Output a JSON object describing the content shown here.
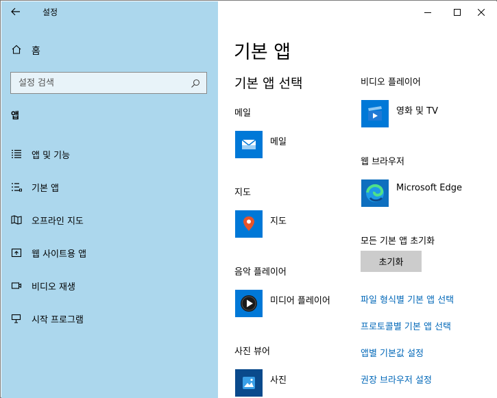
{
  "colors": {
    "sidebar_bg": "#acd7ed",
    "accent_tile": "#0078d7",
    "link": "#0067b8",
    "button_bg": "#cccccc"
  },
  "titlebar": {
    "app_title": "설정",
    "back_icon": "arrow-left-icon",
    "buttons": [
      "minimize-icon",
      "maximize-icon",
      "close-icon"
    ]
  },
  "sidebar": {
    "home_label": "홈",
    "search_placeholder": "설정 검색",
    "section_heading": "앱",
    "items": [
      {
        "label": "앱 및 기능",
        "icon": "apps-features-icon"
      },
      {
        "label": "기본 앱",
        "icon": "default-apps-icon"
      },
      {
        "label": "오프라인 지도",
        "icon": "offline-maps-icon"
      },
      {
        "label": "웹 사이트용 앱",
        "icon": "apps-for-websites-icon"
      },
      {
        "label": "비디오 재생",
        "icon": "video-playback-icon"
      },
      {
        "label": "시작 프로그램",
        "icon": "startup-icon"
      }
    ]
  },
  "main": {
    "page_title": "기본 앱",
    "choose_heading": "기본 앱 선택",
    "categories": [
      {
        "heading": "메일",
        "app": "메일",
        "icon": "mail-app-icon"
      },
      {
        "heading": "지도",
        "app": "지도",
        "icon": "maps-app-icon"
      },
      {
        "heading": "음악 플레이어",
        "app": "미디어 플레이어",
        "icon": "media-player-icon"
      },
      {
        "heading": "사진 뷰어",
        "app": "사진",
        "icon": "photos-app-icon"
      },
      {
        "heading": "비디오 플레이어",
        "app": "영화 및 TV",
        "icon": "movies-tv-icon"
      },
      {
        "heading": "웹 브라우저",
        "app": "Microsoft Edge",
        "icon": "edge-icon"
      }
    ],
    "reset_label": "모든 기본 앱 초기화",
    "reset_button": "초기화",
    "links": [
      "파일 형식별 기본 앱 선택",
      "프로토콜별 기본 앱 선택",
      "앱별 기본값 설정",
      "권장 브라우저 설정"
    ]
  }
}
